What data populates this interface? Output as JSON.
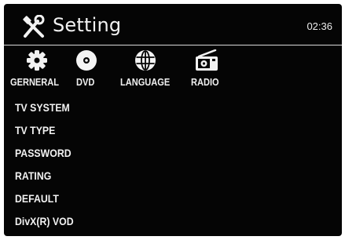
{
  "header": {
    "title": "Setting",
    "clock": "02:36",
    "icon": "tools-icon"
  },
  "tabs": [
    {
      "label": "GERNERAL",
      "icon": "gear-icon",
      "selected": false
    },
    {
      "label": "DVD",
      "icon": "disc-icon",
      "selected": true
    },
    {
      "label": "LANGUAGE",
      "icon": "globe-icon",
      "selected": false
    },
    {
      "label": "RADIO",
      "icon": "radio-icon",
      "selected": false
    }
  ],
  "menu": {
    "items": [
      {
        "label": "TV SYSTEM"
      },
      {
        "label": "TV TYPE"
      },
      {
        "label": "PASSWORD"
      },
      {
        "label": "RATING"
      },
      {
        "label": "DEFAULT"
      },
      {
        "label": "DivX(R) VOD"
      }
    ]
  },
  "colors": {
    "background": "#050505",
    "text": "#f2f2f2",
    "divider": "#d9d9d9"
  }
}
